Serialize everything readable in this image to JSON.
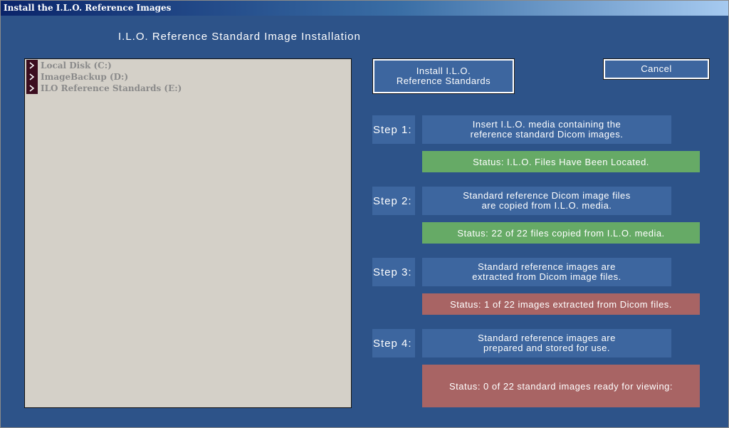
{
  "window": {
    "title": "Install the I.L.O. Reference Images"
  },
  "heading": "I.L.O. Reference Standard Image Installation",
  "drives": [
    {
      "label": "Local Disk (C:)"
    },
    {
      "label": "ImageBackup (D:)"
    },
    {
      "label": "ILO Reference Standards (E:)"
    }
  ],
  "buttons": {
    "install": "Install I.L.O.\nReference Standards",
    "cancel": "Cancel"
  },
  "steps": [
    {
      "label": "Step 1:",
      "description": "Insert I.L.O. media containing the\nreference standard Dicom images.",
      "status": "Status:  I.L.O. Files Have Been Located.",
      "state": "done"
    },
    {
      "label": "Step 2:",
      "description": "Standard reference Dicom image files\nare copied from I.L.O. media.",
      "status": "Status:  22 of 22 files copied from I.L.O. media.",
      "state": "done"
    },
    {
      "label": "Step 3:",
      "description": "Standard reference images are\nextracted from Dicom image files.",
      "status": "Status:  1 of 22 images extracted from Dicom files.",
      "state": "pending"
    },
    {
      "label": "Step 4:",
      "description": "Standard reference images are\nprepared and stored for use.",
      "status": "Status:   0 of 22 standard images ready for viewing:",
      "state": "pending"
    }
  ],
  "colors": {
    "background": "#2d5389",
    "panel": "#3d669f",
    "status_done": "#66aa66",
    "status_pending": "#a86464"
  }
}
